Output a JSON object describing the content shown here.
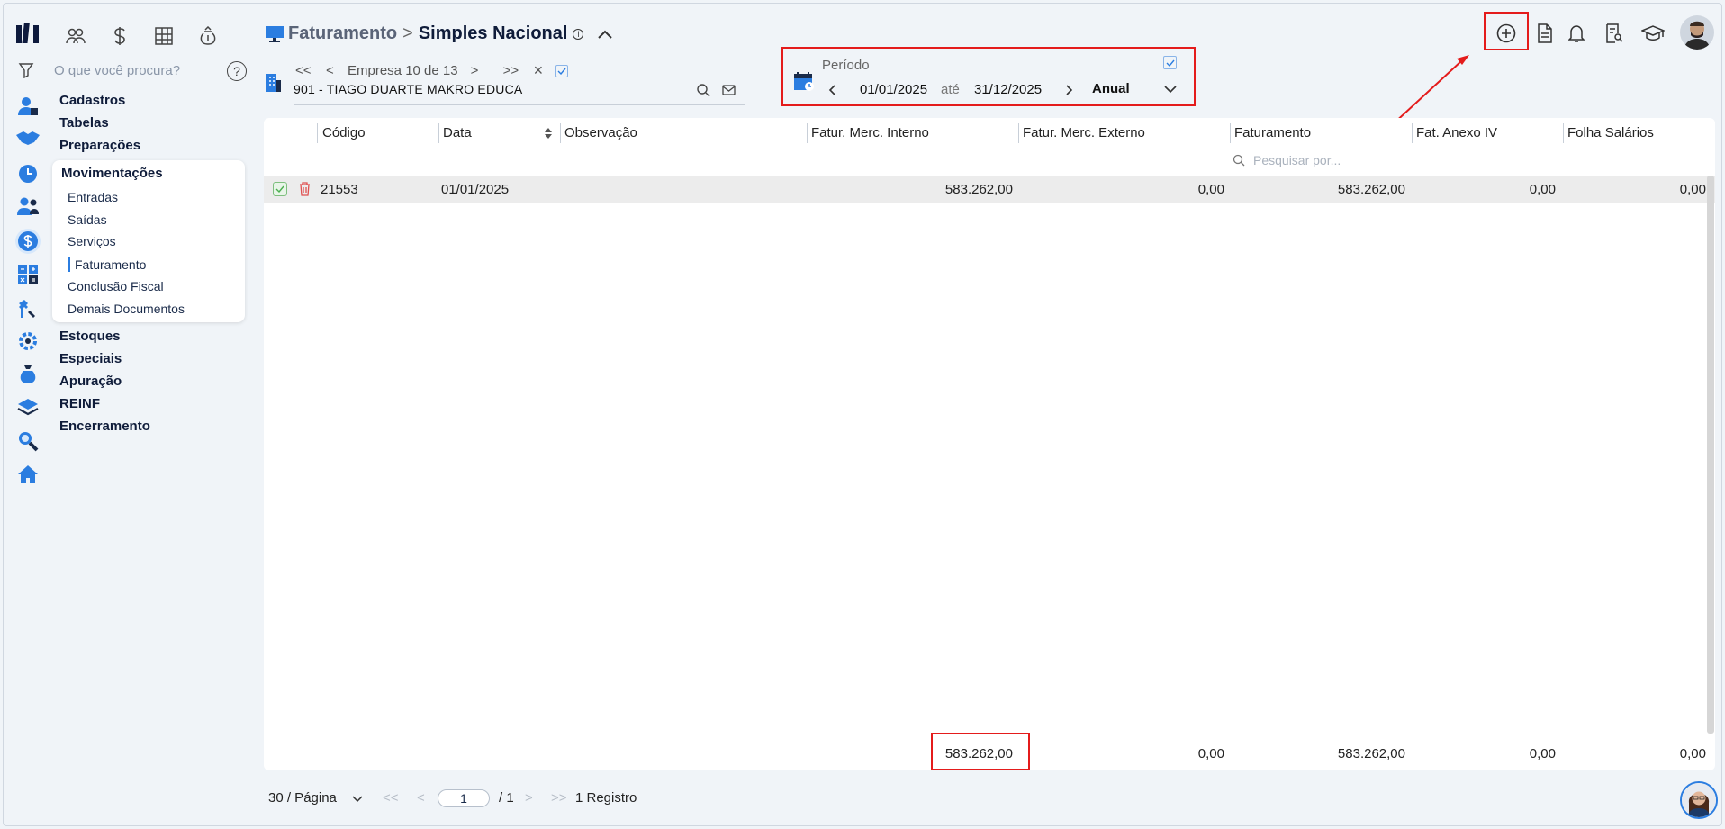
{
  "sidebar": {
    "search_placeholder": "O que você procura?",
    "menu": [
      "Cadastros",
      "Tabelas",
      "Preparações"
    ],
    "submenu_title": "Movimentações",
    "submenu_items": [
      "Entradas",
      "Saídas",
      "Serviços",
      "Faturamento",
      "Conclusão Fiscal",
      "Demais Documentos"
    ],
    "menu_after": [
      "Estoques",
      "Especiais",
      "Apuração",
      "REINF",
      "Encerramento"
    ],
    "help_label": "?"
  },
  "header": {
    "breadcrumb_parent": "Faturamento",
    "separator": ">",
    "breadcrumb_current": "Simples Nacional",
    "info_icon": "i"
  },
  "company_pager": {
    "first": "<<",
    "prev": "<",
    "label": "Empresa 10 de 13",
    "next": ">",
    "last": ">>",
    "close": "×",
    "company_name": "901 - TIAGO DUARTE MAKRO EDUCA"
  },
  "period": {
    "label": "Período",
    "start": "01/01/2025",
    "until_label": "até",
    "end": "31/12/2025",
    "type": "Anual"
  },
  "table": {
    "columns": [
      "Código",
      "Data",
      "Observação",
      "Fatur. Merc. Interno",
      "Fatur. Merc. Externo",
      "Faturamento",
      "Fat. Anexo IV",
      "Folha Salários"
    ],
    "search_placeholder": "Pesquisar por...",
    "rows": [
      {
        "codigo": "21553",
        "data": "01/01/2025",
        "observacao": "",
        "interno": "583.262,00",
        "externo": "0,00",
        "faturamento": "583.262,00",
        "anexo_iv": "0,00",
        "folha": "0,00"
      }
    ],
    "totals": {
      "interno": "583.262,00",
      "externo": "0,00",
      "faturamento": "583.262,00",
      "anexo_iv": "0,00",
      "folha": "0,00"
    }
  },
  "footer": {
    "page_size": "30 / Página",
    "first": "<<",
    "prev": "<",
    "page": "1",
    "of_pages": "/ 1",
    "next": ">",
    "last": ">>",
    "records": "1 Registro"
  },
  "colors": {
    "accent": "#2b7de0",
    "highlight": "#e41b1b",
    "background": "#f0f4f8",
    "delete": "#e05050"
  }
}
